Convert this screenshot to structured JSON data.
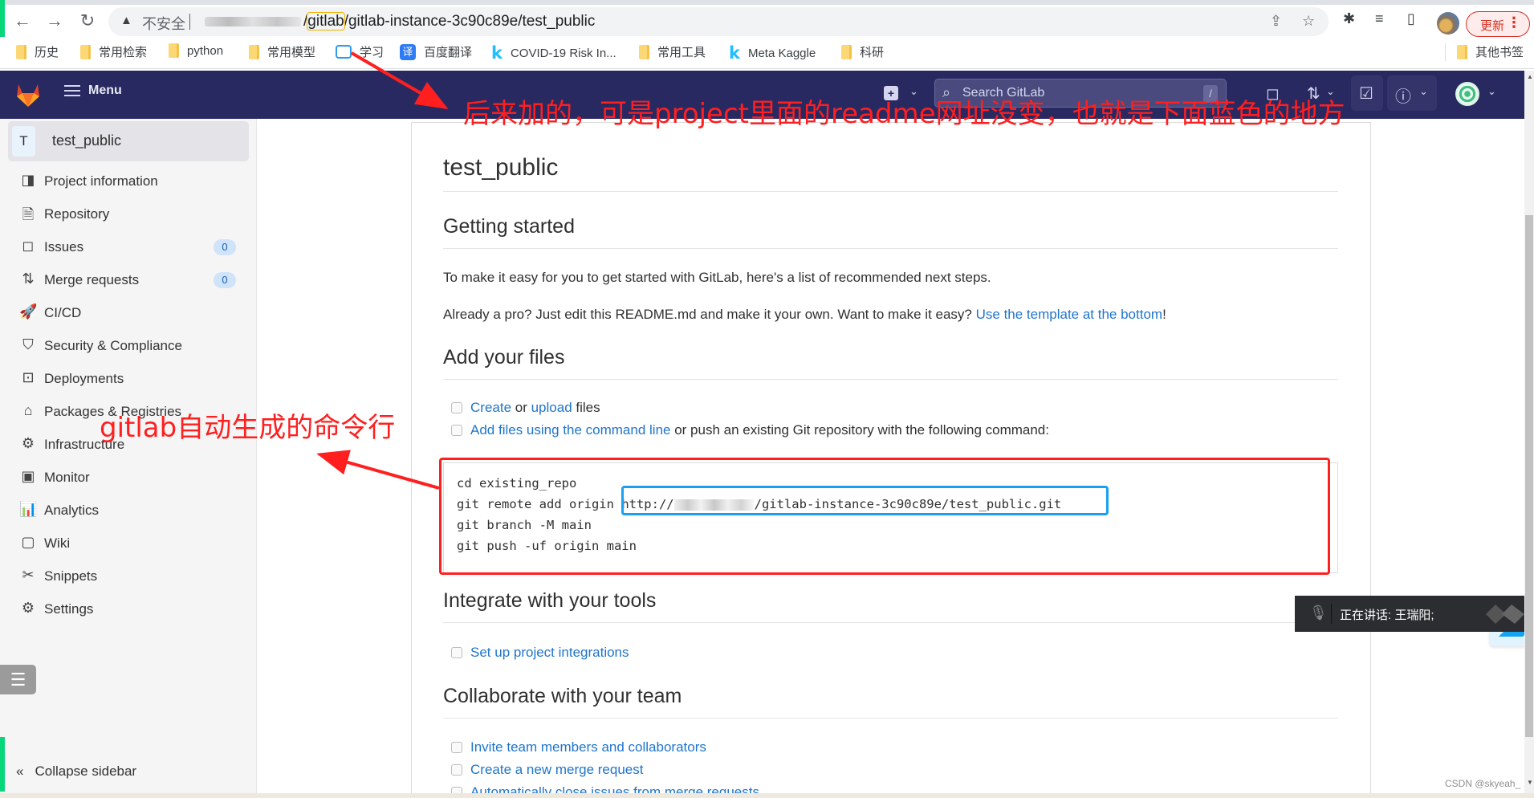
{
  "browser": {
    "insecure_label": "不安全",
    "url_prefix_highlight": "gitlab",
    "url_rest": "/gitlab-instance-3c90c89e/test_public",
    "update_label": "更新",
    "bookmarks": [
      {
        "label": "历史",
        "icon": "folder"
      },
      {
        "label": "常用检索",
        "icon": "folder"
      },
      {
        "label": "python",
        "icon": "folder"
      },
      {
        "label": "常用模型",
        "icon": "folder"
      },
      {
        "label": "学习",
        "icon": "bilibili"
      },
      {
        "label": "百度翻译",
        "icon": "translate"
      },
      {
        "label": "COVID-19 Risk In...",
        "icon": "kaggle"
      },
      {
        "label": "常用工具",
        "icon": "folder"
      },
      {
        "label": "Meta Kaggle",
        "icon": "kaggle"
      },
      {
        "label": "科研",
        "icon": "folder"
      }
    ],
    "other_bookmarks": "其他书签",
    "translate_glyph": "译",
    "kaggle_glyph": "k"
  },
  "navbar": {
    "menu_label": "Menu",
    "search_placeholder": "Search GitLab",
    "search_shortcut": "/"
  },
  "sidebar": {
    "project_initial": "T",
    "project_name": "test_public",
    "items": [
      {
        "label": "Project information",
        "icon": "project-information-icon",
        "glyph": "◨"
      },
      {
        "label": "Repository",
        "icon": "repository-icon",
        "glyph": "🗎"
      },
      {
        "label": "Issues",
        "icon": "issues-icon",
        "glyph": "◻",
        "badge": "0"
      },
      {
        "label": "Merge requests",
        "icon": "merge-request-icon",
        "glyph": "⇅",
        "badge": "0"
      },
      {
        "label": "CI/CD",
        "icon": "rocket-icon",
        "glyph": "🚀"
      },
      {
        "label": "Security & Compliance",
        "icon": "shield-icon",
        "glyph": "⛉"
      },
      {
        "label": "Deployments",
        "icon": "deployments-icon",
        "glyph": "⊡"
      },
      {
        "label": "Packages & Registries",
        "icon": "package-icon",
        "glyph": "⌂"
      },
      {
        "label": "Infrastructure",
        "icon": "infrastructure-icon",
        "glyph": "⚙"
      },
      {
        "label": "Monitor",
        "icon": "monitor-icon",
        "glyph": "▣"
      },
      {
        "label": "Analytics",
        "icon": "analytics-icon",
        "glyph": "📊"
      },
      {
        "label": "Wiki",
        "icon": "wiki-icon",
        "glyph": "▢"
      },
      {
        "label": "Snippets",
        "icon": "snippets-icon",
        "glyph": "✂"
      },
      {
        "label": "Settings",
        "icon": "settings-icon",
        "glyph": "⚙"
      }
    ],
    "collapse_label": "Collapse sidebar"
  },
  "readme": {
    "title": "test_public",
    "getting_started": {
      "heading": "Getting started",
      "intro": "To make it easy for you to get started with GitLab, here's a list of recommended next steps.",
      "pro_text": "Already a pro? Just edit this README.md and make it your own. Want to make it easy? ",
      "pro_link": "Use the template at the bottom",
      "pro_end": "!"
    },
    "add_files": {
      "heading": "Add your files",
      "task1_link1": "Create",
      "task1_mid": " or ",
      "task1_link2": "upload",
      "task1_end": " files",
      "task2_link": "Add files using the command line",
      "task2_end": " or push an existing Git repository with the following command:"
    },
    "code": {
      "line1": "cd existing_repo",
      "line2_prefix": "git remote add origin ",
      "line2_url_start": "http://",
      "line2_url_end": "/gitlab-instance-3c90c89e/test_public.git",
      "line3": "git branch -M main",
      "line4": "git push -uf origin main"
    },
    "integrate": {
      "heading": "Integrate with your tools",
      "tasks": [
        "Set up project integrations"
      ]
    },
    "collaborate": {
      "heading": "Collaborate with your team",
      "tasks": [
        "Invite team members and collaborators",
        "Create a new merge request",
        "Automatically close issues from merge requests"
      ]
    }
  },
  "annotations": {
    "top_note": "后来加的，可是project里面的readme网址没变，也就是下面蓝色的地方",
    "side_note": "gitlab自动生成的命令行",
    "color_red": "#ff1f1f",
    "color_blue": "#1aa0ef"
  },
  "overlay": {
    "voice_status": "正在讲话: 王瑞阳;",
    "watermark": "CSDN @skyeah_"
  }
}
